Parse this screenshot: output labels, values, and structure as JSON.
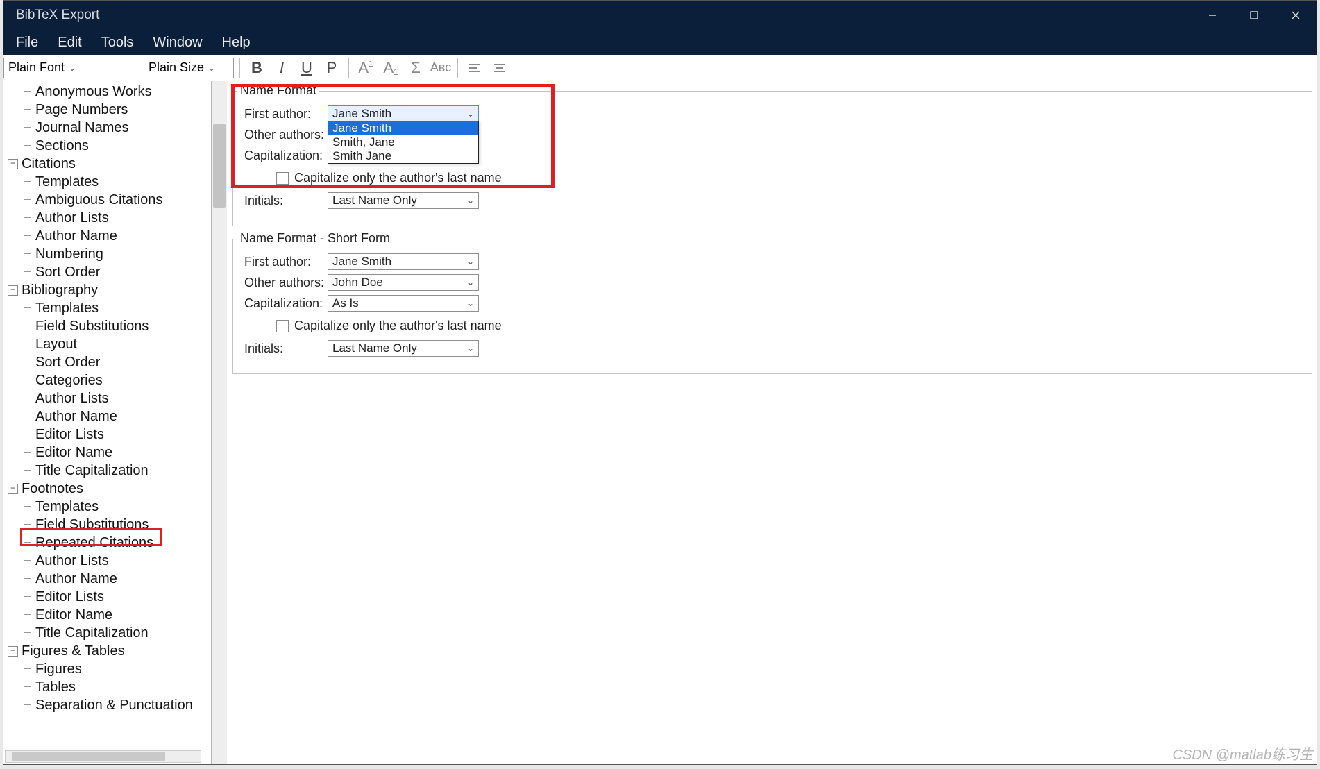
{
  "window": {
    "title": "BibTeX Export"
  },
  "menubar": [
    "File",
    "Edit",
    "Tools",
    "Window",
    "Help"
  ],
  "toolbar": {
    "font_combo": "Plain Font",
    "size_combo": "Plain Size",
    "buttons": {
      "bold": "B",
      "italic": "I",
      "underline": "U",
      "p": "P",
      "sup": "A",
      "sub": "A",
      "sigma": "Σ",
      "smallcaps": "Aʙᴄ",
      "align_left": "≡",
      "align_center": "≡"
    }
  },
  "tree": [
    {
      "label": "Anonymous Works",
      "type": "leaf"
    },
    {
      "label": "Page Numbers",
      "type": "leaf"
    },
    {
      "label": "Journal Names",
      "type": "leaf"
    },
    {
      "label": "Sections",
      "type": "leaf"
    },
    {
      "label": "Citations",
      "type": "parent",
      "children": [
        "Templates",
        "Ambiguous Citations",
        "Author Lists",
        "Author Name",
        "Numbering",
        "Sort Order"
      ]
    },
    {
      "label": "Bibliography",
      "type": "parent",
      "children": [
        "Templates",
        "Field Substitutions",
        "Layout",
        "Sort Order",
        "Categories",
        "Author Lists",
        "Author Name",
        "Editor Lists",
        "Editor Name",
        "Title Capitalization"
      ]
    },
    {
      "label": "Footnotes",
      "type": "parent",
      "children": [
        "Templates",
        "Field Substitutions",
        "Repeated Citations",
        "Author Lists",
        "Author Name",
        "Editor Lists",
        "Editor Name",
        "Title Capitalization"
      ]
    },
    {
      "label": "Figures & Tables",
      "type": "parent",
      "children": [
        "Figures",
        "Tables",
        "Separation & Punctuation"
      ]
    }
  ],
  "form": {
    "group1": {
      "title": "Name Format",
      "first_author_label": "First author:",
      "first_author_value": "Jane Smith",
      "first_author_options": [
        "Jane Smith",
        "Smith, Jane",
        "Smith Jane"
      ],
      "other_authors_label": "Other authors:",
      "capitalization_label": "Capitalization:",
      "capitalize_checkbox": "Capitalize only the author's last name",
      "initials_label": "Initials:",
      "initials_value": "Last Name Only"
    },
    "group2": {
      "title": "Name Format - Short Form",
      "first_author_label": "First author:",
      "first_author_value": "Jane Smith",
      "other_authors_label": "Other authors:",
      "other_authors_value": "John Doe",
      "capitalization_label": "Capitalization:",
      "capitalization_value": "As Is",
      "capitalize_checkbox": "Capitalize only the author's last name",
      "initials_label": "Initials:",
      "initials_value": "Last Name Only"
    }
  },
  "watermark": "CSDN @matlab练习生"
}
